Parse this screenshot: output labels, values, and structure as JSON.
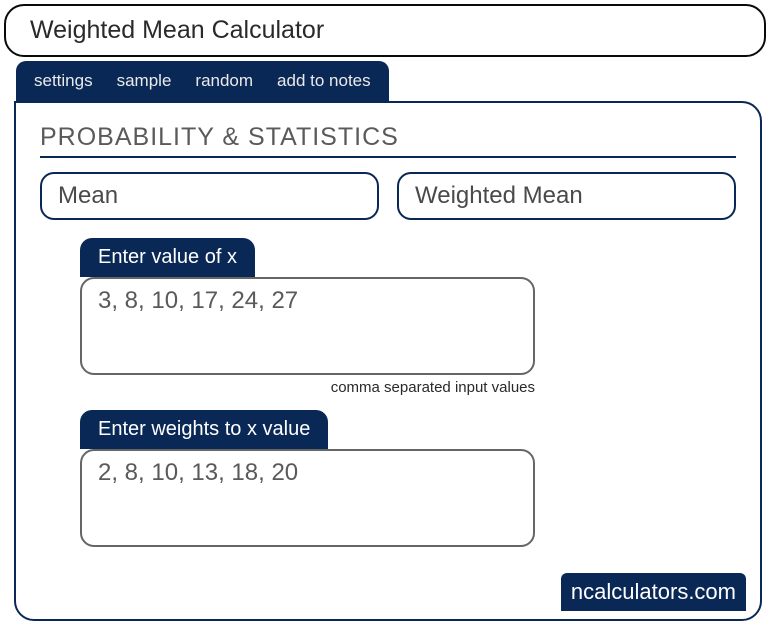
{
  "title": "Weighted Mean Calculator",
  "toolbar": {
    "settings": "settings",
    "sample": "sample",
    "random": "random",
    "add_to_notes": "add to notes"
  },
  "section_heading": "PROBABILITY & STATISTICS",
  "tabs": {
    "mean": "Mean",
    "weighted_mean": "Weighted Mean"
  },
  "inputs": {
    "x_label": "Enter value of x",
    "x_value": "3, 8, 10, 17, 24, 27",
    "x_hint": "comma separated input values",
    "weights_label": "Enter weights to x value",
    "weights_value": "2, 8, 10, 13, 18, 20"
  },
  "brand": "ncalculators.com"
}
